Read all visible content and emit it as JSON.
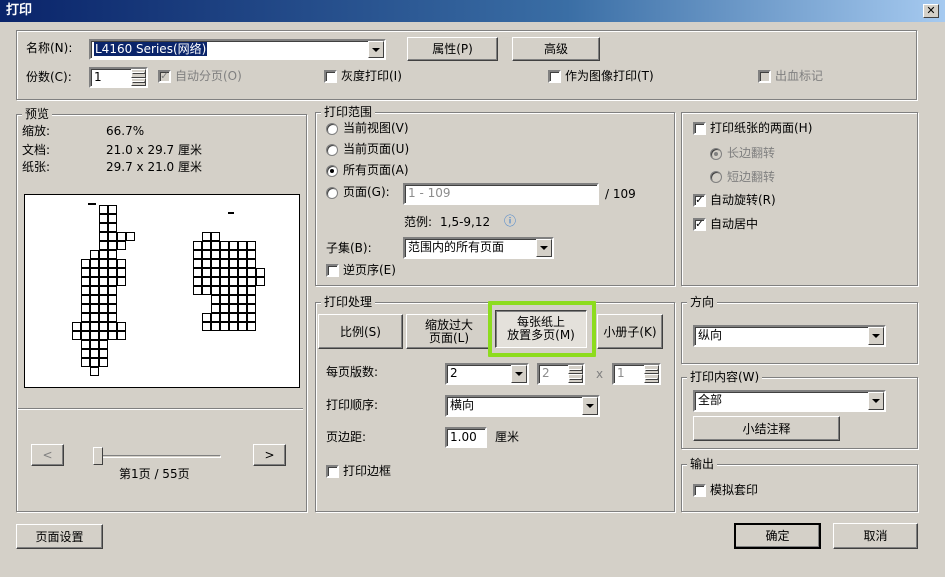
{
  "window": {
    "title": "打印",
    "close_label": "✕"
  },
  "printer": {
    "name_label": "名称(N):",
    "name_value": "L4160 Series(网络)",
    "properties_btn": "属性(P)",
    "advanced_btn": "高级",
    "copies_label": "份数(C):",
    "copies_value": "1",
    "collate_label": "自动分页(O)",
    "grayscale_label": "灰度打印(I)",
    "as_image_label": "作为图像打印(T)",
    "bleed_label": "出血标记"
  },
  "preview": {
    "legend": "预览",
    "zoom_label": "缩放:",
    "zoom_value": "66.7%",
    "doc_label": "文档:",
    "doc_value": "21.0 x 29.7 厘米",
    "paper_label": "纸张:",
    "paper_value": "29.7 x 21.0 厘米",
    "prev_btn": "<",
    "next_btn": ">",
    "page_indicator": "第1页 / 55页"
  },
  "range": {
    "legend": "打印范围",
    "current_view": "当前视图(V)",
    "current_page": "当前页面(U)",
    "all_pages": "所有页面(A)",
    "pages": "页面(G):",
    "pages_placeholder": "1 - 109",
    "pages_total": "/ 109",
    "example_label": "范例:",
    "example_value": "1,5-9,12",
    "info_icon": "ⓘ",
    "subset_label": "子集(B):",
    "subset_value": "范围内的所有页面",
    "reverse_label": "逆页序(E)"
  },
  "handling": {
    "legend": "打印处理",
    "tabs": [
      "比例(S)",
      "缩放过大|页面(L)",
      "每张纸上|放置多页(M)",
      "小册子(K)"
    ],
    "pages_per_sheet_label": "每页版数:",
    "pages_per_sheet_value": "2",
    "cols_value": "2",
    "x_label": "x",
    "rows_value": "1",
    "order_label": "打印顺序:",
    "order_value": "横向",
    "margin_label": "页边距:",
    "margin_value": "1.00",
    "margin_unit": "厘米",
    "border_label": "打印边框"
  },
  "duplex": {
    "both_sides_label": "打印纸张的两面(H)",
    "long_edge": "长边翻转",
    "short_edge": "短边翻转",
    "auto_rotate": "自动旋转(R)",
    "auto_center": "自动居中"
  },
  "orientation": {
    "legend": "方向",
    "value": "纵向"
  },
  "content": {
    "legend": "打印内容(W)",
    "value": "全部",
    "summarize_btn": "小结注释"
  },
  "output": {
    "legend": "输出",
    "simulate_label": "模拟套印"
  },
  "footer": {
    "page_setup_btn": "页面设置",
    "ok_btn": "确定",
    "cancel_btn": "取消"
  }
}
